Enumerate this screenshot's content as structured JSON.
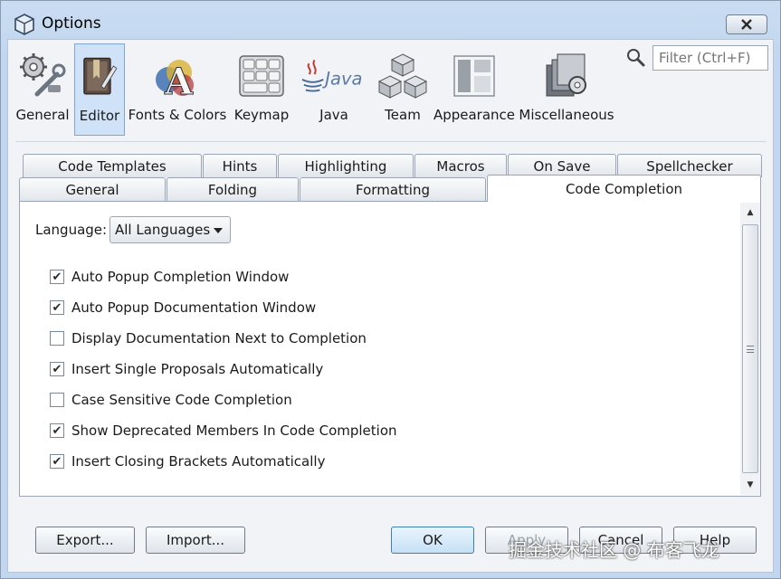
{
  "window": {
    "title": "Options"
  },
  "categories": [
    {
      "label": "General",
      "icon": "gears-wrench-icon",
      "selected": false
    },
    {
      "label": "Editor",
      "icon": "editor-book-icon",
      "selected": true
    },
    {
      "label": "Fonts & Colors",
      "icon": "fonts-colors-icon",
      "selected": false
    },
    {
      "label": "Keymap",
      "icon": "keyboard-icon",
      "selected": false
    },
    {
      "label": "Java",
      "icon": "java-logo-icon",
      "selected": false
    },
    {
      "label": "Team",
      "icon": "team-cubes-icon",
      "selected": false
    },
    {
      "label": "Appearance",
      "icon": "appearance-windows-icon",
      "selected": false
    },
    {
      "label": "Miscellaneous",
      "icon": "miscellaneous-icon",
      "selected": false
    }
  ],
  "filter": {
    "placeholder": "Filter (Ctrl+F)"
  },
  "tabs_row1": [
    "Code Templates",
    "Hints",
    "Highlighting",
    "Macros",
    "On Save",
    "Spellchecker"
  ],
  "tabs_row2": [
    "General",
    "Folding",
    "Formatting",
    "Code Completion"
  ],
  "active_tab": "Code Completion",
  "panel": {
    "language_label": "Language:",
    "language_value": "All Languages",
    "options": [
      {
        "label": "Auto Popup Completion Window",
        "checked": true
      },
      {
        "label": "Auto Popup Documentation Window",
        "checked": true
      },
      {
        "label": "Display Documentation Next to Completion",
        "checked": false
      },
      {
        "label": "Insert Single Proposals Automatically",
        "checked": true
      },
      {
        "label": "Case Sensitive Code Completion",
        "checked": false
      },
      {
        "label": "Show Deprecated Members In Code Completion",
        "checked": true
      },
      {
        "label": "Insert Closing Brackets Automatically",
        "checked": true
      }
    ]
  },
  "buttons": {
    "export": "Export...",
    "import": "Import...",
    "ok": "OK",
    "apply": "Apply",
    "cancel": "Cancel",
    "help": "Help"
  },
  "watermark": "掘金技术社区 @ 布客飞龙",
  "colors": {
    "accent": "#7fa7d6",
    "window_bg": "#c2d7ef",
    "selected_category": "#cfe2f8"
  }
}
